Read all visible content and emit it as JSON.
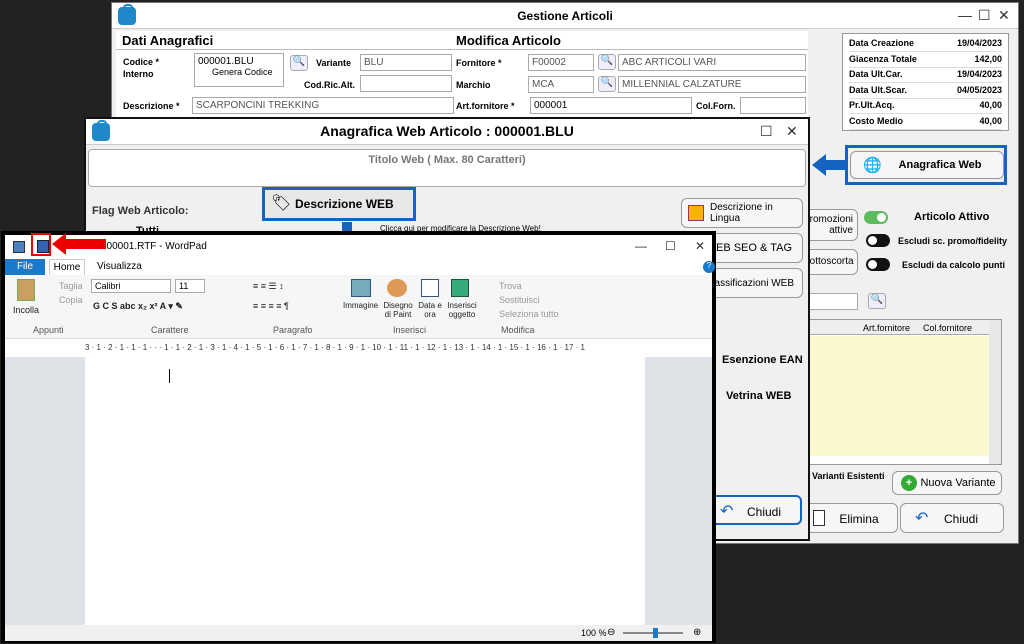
{
  "gestione": {
    "title": "Gestione Articoli",
    "section_left": "Dati Anagrafici",
    "section_right": "Modifica Articolo",
    "codice_label": "Codice *",
    "interno_label": "Interno",
    "codice_value": "000001.BLU",
    "genera_codice": "Genera Codice",
    "variante_label": "Variante",
    "variante_value": "BLU",
    "cod_ric_alt_label": "Cod.Ric.Alt.",
    "fornitore_label": "Fornitore *",
    "fornitore_code": "F00002",
    "fornitore_name": "ABC ARTICOLI VARI",
    "marchio_label": "Marchio",
    "marchio_code": "MCA",
    "marchio_name": "MILLENNIAL CALZATURE",
    "descrizione_label": "Descrizione *",
    "descrizione_value": "SCARPONCINI TREKKING",
    "art_fornitore_label": "Art.fornitore *",
    "art_fornitore_value": "000001",
    "col_forn_label": "Col.Forn.",
    "info": [
      {
        "label": "Data Creazione",
        "value": "19/04/2023"
      },
      {
        "label": "Giacenza Totale",
        "value": "142,00"
      },
      {
        "label": "Data Ult.Car.",
        "value": "19/04/2023"
      },
      {
        "label": "Data Ult.Scar.",
        "value": "04/05/2023"
      },
      {
        "label": "Pr.Ult.Acq.",
        "value": "40,00"
      },
      {
        "label": "Costo Medio",
        "value": "40,00"
      }
    ],
    "anagrafica_web": "Anagrafica Web",
    "promozioni": "Promozioni attive",
    "sottoscorta": "Sottoscorta",
    "articolo_attivo": "Articolo Attivo",
    "escludi_promo": "Escludi sc. promo/fidelity",
    "escludi_punti": "Escludi da calcolo punti",
    "col_art_fornitore": "Art.fornitore",
    "col_col_fornitore": "Col.fornitore",
    "varianti_esistenti": "Varianti Esistenti",
    "nuova_variante": "Nuova Variante",
    "elimina": "Elimina",
    "chiudi": "Chiudi"
  },
  "web": {
    "title": "Anagrafica Web Articolo : 000001.BLU",
    "titolo_web": "Titolo Web ( Max. 80 Caratteri)",
    "flag_web": "Flag Web Articolo:",
    "tutti": "Tutti",
    "descrizione_web": "Descrizione WEB",
    "clicca_qui": "Clicca qui per modificare la Descrizione Web!",
    "descrizione_lingua": "Descrizione in Lingua",
    "web_seo": "WEB SEO & TAG",
    "classificazioni": "Classificazioni WEB",
    "esenzione_ean": "Esenzione EAN",
    "vetrina_web": "Vetrina WEB",
    "chiudi": "Chiudi"
  },
  "wordpad": {
    "title": "000001.RTF - WordPad",
    "tabs": [
      "File",
      "Home",
      "Visualizza"
    ],
    "incolla": "Incolla",
    "taglia": "Taglia",
    "copia": "Copia",
    "appunti": "Appunti",
    "font_name": "Calibri",
    "font_size": "11",
    "carattere": "Carattere",
    "paragrafo": "Paragrafo",
    "immagine": "Immagine",
    "disegno": "Disegno di Paint",
    "data_ora": "Data e ora",
    "inserisci_oggetto": "Inserisci oggetto",
    "inserisci": "Inserisci",
    "trova": "Trova",
    "sostituisci": "Sostituisci",
    "seleziona_tutto": "Seleziona tutto",
    "modifica": "Modifica",
    "ruler": "3 · 1 · 2 · 1 · 1 · 1 · · · 1 · 1 · 2 · 1 · 3 · 1 · 4 · 1 · 5 · 1 · 6 · 1 · 7 · 1 · 8 · 1 · 9 · 1 · 10 · 1 · 11 · 1 · 12 · 1 · 13 · 1 · 14 · 1 · 15 · 1 · 16 · 1 · 17 · 1",
    "zoom": "100 %"
  }
}
